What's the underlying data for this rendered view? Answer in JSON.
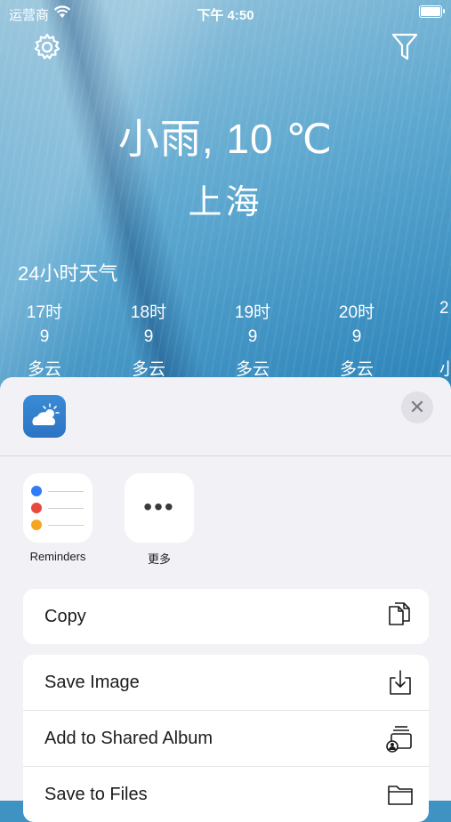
{
  "status": {
    "carrier": "运营商",
    "time": "下午 4:50"
  },
  "weather": {
    "title": "小雨, 10 ℃",
    "city": "上海",
    "hourly_heading": "24小时天气",
    "hours": [
      {
        "time": "17时",
        "temp": "9",
        "cond": "多云"
      },
      {
        "time": "18时",
        "temp": "9",
        "cond": "多云"
      },
      {
        "time": "19时",
        "temp": "9",
        "cond": "多云"
      },
      {
        "time": "20时",
        "temp": "9",
        "cond": "多云"
      },
      {
        "time": "2",
        "temp": "",
        "cond": "小"
      }
    ]
  },
  "share_sheet": {
    "apps": [
      {
        "label": "Reminders"
      },
      {
        "label": "更多"
      }
    ],
    "close_glyph": "✕",
    "more_glyph": "•••",
    "actions_group1": [
      {
        "label": "Copy"
      }
    ],
    "actions_group2": [
      {
        "label": "Save Image"
      },
      {
        "label": "Add to Shared Album"
      },
      {
        "label": "Save to Files"
      }
    ]
  },
  "colors": {
    "sheet_bg": "#f2f2f6",
    "app_icon_blue": "#2b74c4",
    "reminder_blue": "#2f7cf6",
    "reminder_red": "#e9483f",
    "reminder_orange": "#f4a623"
  },
  "icons": [
    "wifi-icon",
    "battery-icon",
    "gear-icon",
    "filter-icon",
    "weather-app-icon",
    "close-icon",
    "copy-icon",
    "save-image-icon",
    "shared-album-icon",
    "folder-icon"
  ]
}
